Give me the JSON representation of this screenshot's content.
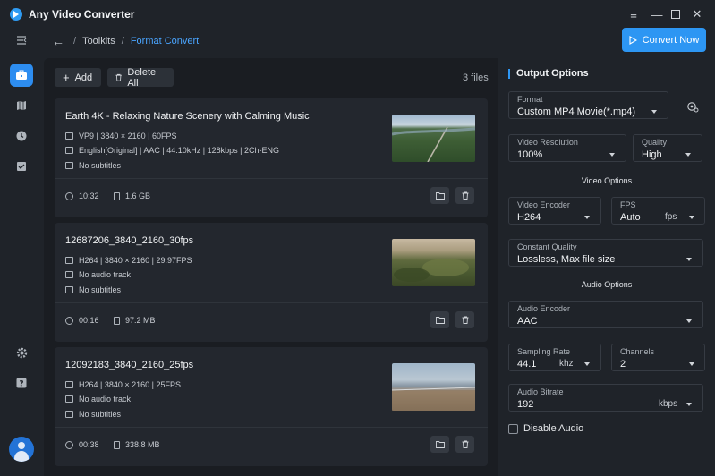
{
  "app": {
    "title": "Any Video Converter"
  },
  "breadcrumb": {
    "root": "Toolkits",
    "current": "Format Convert"
  },
  "toolbar": {
    "add_label": "Add",
    "delete_all_label": "Delete All",
    "file_count": "3 files",
    "convert_label": "Convert Now"
  },
  "files": [
    {
      "title": "Earth 4K - Relaxing Nature Scenery with Calming Music",
      "video": "VP9 | 3840 × 2160 | 60FPS",
      "audio": "English[Original] | AAC | 44.10kHz | 128kbps | 2Ch-ENG",
      "subtitles": "No subtitles",
      "duration": "10:32",
      "size": "1.6 GB"
    },
    {
      "title": "12687206_3840_2160_30fps",
      "video": "H264 | 3840 × 2160 | 29.97FPS",
      "audio": "No audio track",
      "subtitles": "No subtitles",
      "duration": "00:16",
      "size": "97.2 MB"
    },
    {
      "title": "12092183_3840_2160_25fps",
      "video": "H264 | 3840 × 2160 | 25FPS",
      "audio": "No audio track",
      "subtitles": "No subtitles",
      "duration": "00:38",
      "size": "338.8 MB"
    }
  ],
  "options": {
    "title": "Output Options",
    "format": {
      "label": "Format",
      "value": "Custom MP4 Movie(*.mp4)"
    },
    "resolution": {
      "label": "Video Resolution",
      "value": "100%"
    },
    "quality": {
      "label": "Quality",
      "value": "High"
    },
    "video_section": "Video Options",
    "video_encoder": {
      "label": "Video Encoder",
      "value": "H264"
    },
    "fps": {
      "label": "FPS",
      "value": "Auto",
      "unit": "fps"
    },
    "constant_quality": {
      "label": "Constant Quality",
      "value": "Lossless, Max file size"
    },
    "audio_section": "Audio Options",
    "audio_encoder": {
      "label": "Audio Encoder",
      "value": "AAC"
    },
    "sampling_rate": {
      "label": "Sampling Rate",
      "value": "44.1",
      "unit": "khz"
    },
    "channels": {
      "label": "Channels",
      "value": "2"
    },
    "audio_bitrate": {
      "label": "Audio Bitrate",
      "value": "192",
      "unit": "kbps"
    },
    "disable_audio_label": "Disable Audio"
  },
  "colors": {
    "accent": "#2d96f3",
    "background": "#1f2329",
    "panel": "#1a1d22",
    "card": "#23272e"
  }
}
